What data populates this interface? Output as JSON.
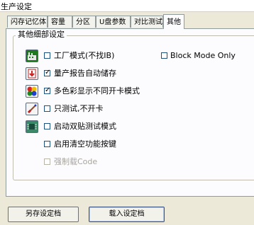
{
  "window": {
    "title": "生产设定"
  },
  "tabs": [
    {
      "label": "闪存记忆体"
    },
    {
      "label": "容量"
    },
    {
      "label": "分区"
    },
    {
      "label": "U盘参数"
    },
    {
      "label": "对比测试"
    },
    {
      "label": "其他",
      "active": true
    }
  ],
  "group": {
    "title": "其他细部设定"
  },
  "options": [
    {
      "label": "工厂模式(不找IB)",
      "checked": false,
      "enabled": true,
      "icon": "factory-icon"
    },
    {
      "label": "量产报告自动储存",
      "checked": true,
      "enabled": true,
      "icon": "save-report-icon"
    },
    {
      "label": "多色彩显示不同开卡模式",
      "checked": true,
      "enabled": true,
      "icon": "color-display-icon"
    },
    {
      "label": "只测试,不开卡",
      "checked": false,
      "enabled": true,
      "icon": "test-only-icon"
    },
    {
      "label": "启动双贴测试模式",
      "checked": false,
      "enabled": true,
      "icon": "chip-icon"
    },
    {
      "label": "启用清空功能按键",
      "checked": false,
      "enabled": true
    },
    {
      "label": "强制载Code",
      "checked": false,
      "enabled": false
    }
  ],
  "block_mode": {
    "label": "Block Mode Only",
    "checked": false
  },
  "buttons": {
    "save": "另存设定档",
    "load": "载入设定档"
  },
  "colors": {
    "background": "#ece9d8",
    "panel": "#fcfcfe",
    "border": "#919b9c",
    "disabled_text": "#a7a59d"
  }
}
